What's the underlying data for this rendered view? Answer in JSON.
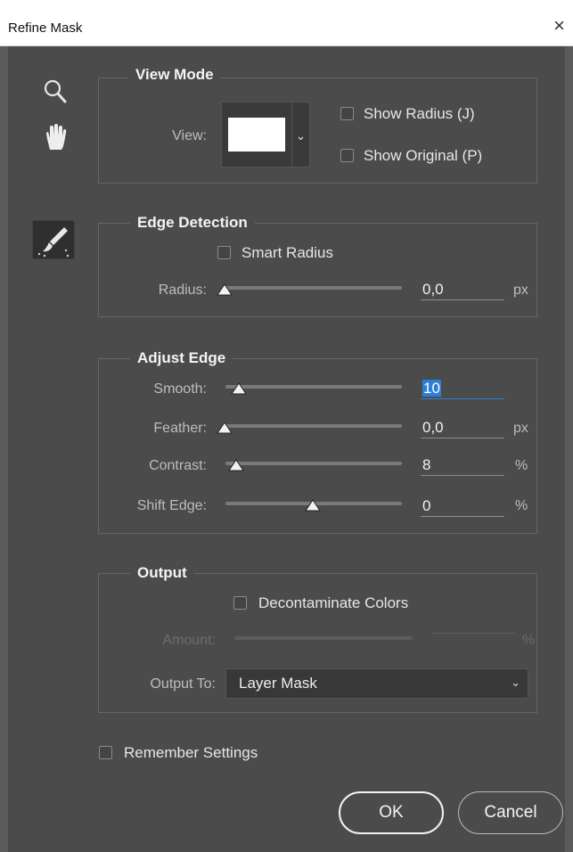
{
  "window": {
    "title": "Refine Mask",
    "close_glyph": "×"
  },
  "tools": [
    "zoom-icon",
    "hand-icon",
    "refine-radius-brush-icon"
  ],
  "view_mode": {
    "heading": "View Mode",
    "view_label": "View:",
    "show_radius": {
      "label": "Show Radius (J)",
      "checked": false
    },
    "show_original": {
      "label": "Show Original (P)",
      "checked": false
    }
  },
  "edge_detection": {
    "heading": "Edge Detection",
    "smart_radius": {
      "label": "Smart Radius",
      "checked": false
    },
    "radius": {
      "label": "Radius:",
      "value": "0,0",
      "unit": "px"
    }
  },
  "adjust_edge": {
    "heading": "Adjust Edge",
    "smooth": {
      "label": "Smooth:",
      "value": "10",
      "unit": ""
    },
    "feather": {
      "label": "Feather:",
      "value": "0,0",
      "unit": "px"
    },
    "contrast": {
      "label": "Contrast:",
      "value": "8",
      "unit": "%"
    },
    "shift_edge": {
      "label": "Shift Edge:",
      "value": "0",
      "unit": "%"
    }
  },
  "output": {
    "heading": "Output",
    "decontaminate": {
      "label": "Decontaminate Colors",
      "checked": false
    },
    "amount": {
      "label": "Amount:",
      "value": "",
      "unit": "%"
    },
    "output_to": {
      "label": "Output To:",
      "selected": "Layer Mask"
    }
  },
  "remember_settings": {
    "label": "Remember Settings",
    "checked": false
  },
  "buttons": {
    "ok": "OK",
    "cancel": "Cancel"
  }
}
